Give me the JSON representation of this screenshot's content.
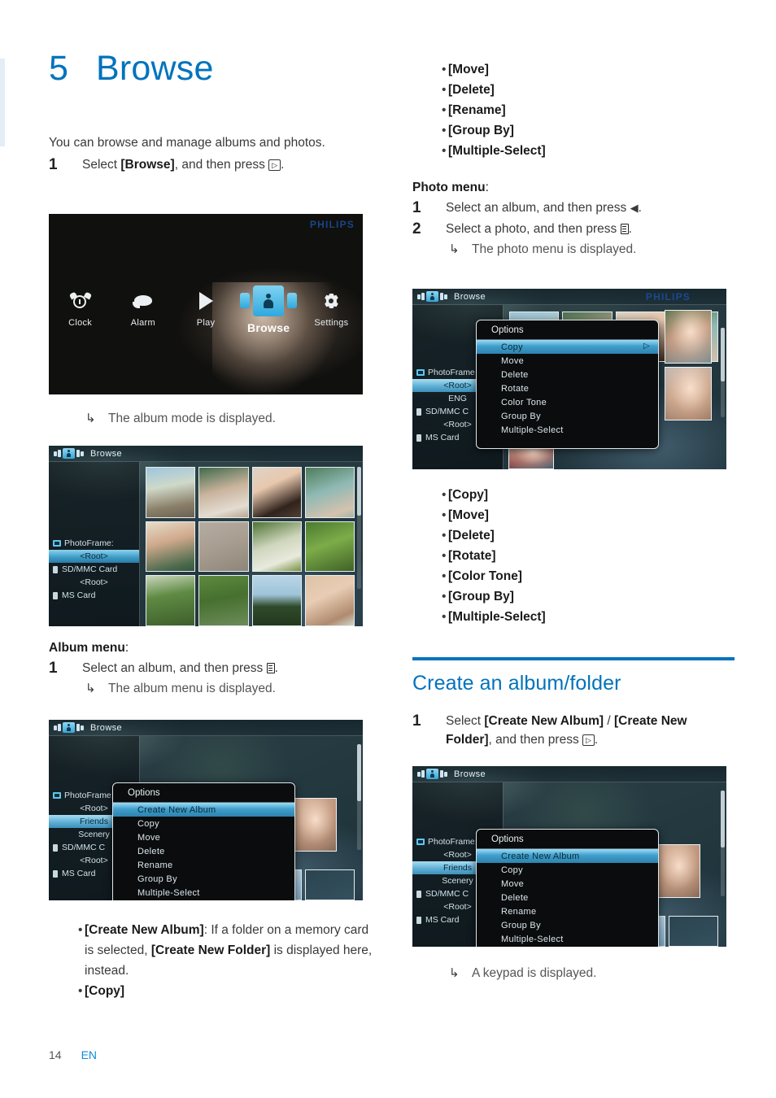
{
  "chapter": {
    "number": "5",
    "title": "Browse"
  },
  "left_column": {
    "intro": "You can browse and manage albums and photos.",
    "step1": {
      "num": "1",
      "text_before": "Select ",
      "bold": "[Browse]",
      "text_after": ", and then press "
    },
    "result1": {
      "arrow": "↳",
      "text": "The album mode is displayed."
    },
    "album_menu_label": "Album menu",
    "album_menu_colon": ":",
    "step_album": {
      "num": "1",
      "text_before": "Select an album, and then press "
    },
    "result_album": {
      "arrow": "↳",
      "text": "The album menu is displayed."
    },
    "bullets": [
      {
        "bold1": "[Create New Album]",
        "mid": ": If a folder on a memory card is selected, ",
        "bold2": "[Create New Folder]",
        "tail": " is displayed here, instead."
      },
      {
        "bold1": "[Copy]",
        "mid": "",
        "bold2": "",
        "tail": ""
      }
    ]
  },
  "right_column": {
    "top_bullets": [
      "[Move]",
      "[Delete]",
      "[Rename]",
      "[Group By]",
      "[Multiple-Select]"
    ],
    "photo_menu_label": "Photo menu",
    "photo_menu_colon": ":",
    "step1": {
      "num": "1",
      "text": "Select an album, and then press "
    },
    "step2": {
      "num": "2",
      "text": "Select a photo, and then press "
    },
    "result2": {
      "arrow": "↳",
      "text": "The photo menu is displayed."
    },
    "photo_bullets": [
      "[Copy]",
      "[Move]",
      "[Delete]",
      "[Rotate]",
      "[Color Tone]",
      "[Group By]",
      "[Multiple-Select]"
    ],
    "section_title": "Create an album/folder",
    "step_create": {
      "num": "1",
      "text_before": "Select ",
      "bold1": "[Create New Album]",
      "slash": " / ",
      "bold2": "[Create New Folder]",
      "text_after": ", and then press "
    },
    "result_create": {
      "arrow": "↳",
      "text": "A keypad is displayed."
    }
  },
  "screenshots": {
    "home": {
      "brand": "PHILIPS",
      "items": [
        {
          "label": "Clock",
          "icon": "alarm-clock-icon",
          "selected": false
        },
        {
          "label": "Alarm",
          "icon": "bell-icon",
          "selected": false
        },
        {
          "label": "Play",
          "icon": "play-icon",
          "selected": false
        },
        {
          "label": "Browse",
          "icon": "person-card-icon",
          "selected": true
        },
        {
          "label": "Settings",
          "icon": "gear-icon",
          "selected": false
        }
      ]
    },
    "browse_albums": {
      "title": "Browse",
      "sidebar": [
        {
          "label": "PhotoFrame:",
          "type": "device",
          "selected": false
        },
        {
          "label": "<Root>",
          "type": "child",
          "selected": true
        },
        {
          "label": "SD/MMC Card",
          "type": "card",
          "selected": false
        },
        {
          "label": "<Root>",
          "type": "child",
          "selected": false
        },
        {
          "label": "MS Card",
          "type": "card",
          "selected": false
        }
      ]
    },
    "album_menu": {
      "title": "Browse",
      "options_header": "Options",
      "options": [
        {
          "label": "Create New Album",
          "selected": true,
          "caret": ""
        },
        {
          "label": "Copy",
          "selected": false,
          "caret": ""
        },
        {
          "label": "Move",
          "selected": false,
          "caret": ""
        },
        {
          "label": "Delete",
          "selected": false,
          "caret": ""
        },
        {
          "label": "Rename",
          "selected": false,
          "caret": ""
        },
        {
          "label": "Group By",
          "selected": false,
          "caret": ""
        },
        {
          "label": "Multiple-Select",
          "selected": false,
          "caret": ""
        }
      ],
      "sidebar": [
        {
          "label": "PhotoFrame:",
          "type": "device",
          "selected": false
        },
        {
          "label": "<Root>",
          "type": "child",
          "selected": false
        },
        {
          "label": "Friends",
          "type": "child",
          "selected": true
        },
        {
          "label": "Scenery",
          "type": "child",
          "selected": false
        },
        {
          "label": "SD/MMC C",
          "type": "card",
          "selected": false
        },
        {
          "label": "<Root>",
          "type": "child",
          "selected": false
        },
        {
          "label": "MS Card",
          "type": "card",
          "selected": false
        }
      ]
    },
    "photo_menu": {
      "title": "Browse",
      "brand": "PHILIPS",
      "options_header": "Options",
      "options": [
        {
          "label": "Copy",
          "selected": true,
          "caret": "▷"
        },
        {
          "label": "Move",
          "selected": false,
          "caret": ""
        },
        {
          "label": "Delete",
          "selected": false,
          "caret": ""
        },
        {
          "label": "Rotate",
          "selected": false,
          "caret": ""
        },
        {
          "label": "Color Tone",
          "selected": false,
          "caret": ""
        },
        {
          "label": "Group By",
          "selected": false,
          "caret": ""
        },
        {
          "label": "Multiple-Select",
          "selected": false,
          "caret": ""
        }
      ],
      "sidebar": [
        {
          "label": "PhotoFrame",
          "type": "device",
          "selected": false
        },
        {
          "label": "<Root>",
          "type": "child",
          "selected": true
        },
        {
          "label": "ENG",
          "type": "child",
          "selected": false
        },
        {
          "label": "SD/MMC C",
          "type": "card",
          "selected": false
        },
        {
          "label": "<Root>",
          "type": "child",
          "selected": false
        },
        {
          "label": "MS Card",
          "type": "card",
          "selected": false
        }
      ]
    },
    "create_album": {
      "title": "Browse",
      "options_header": "Options",
      "options": [
        {
          "label": "Create New Album",
          "selected": true,
          "caret": ""
        },
        {
          "label": "Copy",
          "selected": false,
          "caret": ""
        },
        {
          "label": "Move",
          "selected": false,
          "caret": ""
        },
        {
          "label": "Delete",
          "selected": false,
          "caret": ""
        },
        {
          "label": "Rename",
          "selected": false,
          "caret": ""
        },
        {
          "label": "Group By",
          "selected": false,
          "caret": ""
        },
        {
          "label": "Multiple-Select",
          "selected": false,
          "caret": ""
        }
      ],
      "sidebar": [
        {
          "label": "PhotoFrame:",
          "type": "device",
          "selected": false
        },
        {
          "label": "<Root>",
          "type": "child",
          "selected": false
        },
        {
          "label": "Friends",
          "type": "child",
          "selected": true
        },
        {
          "label": "Scenery",
          "type": "child",
          "selected": false
        },
        {
          "label": "SD/MMC C",
          "type": "card",
          "selected": false
        },
        {
          "label": "<Root>",
          "type": "child",
          "selected": false
        },
        {
          "label": "MS Card",
          "type": "card",
          "selected": false
        }
      ]
    }
  },
  "footer": {
    "page": "14",
    "lang": "EN"
  },
  "colors": {
    "accent": "#0073bd",
    "link": "#0c8ddb",
    "body": "#3a3a3a"
  }
}
